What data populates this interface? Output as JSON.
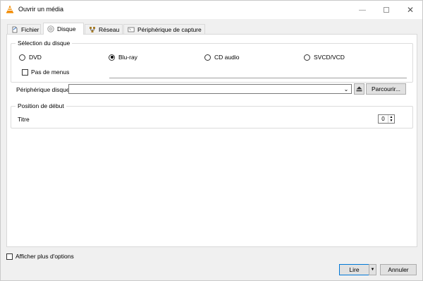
{
  "window": {
    "title": "Ouvrir un média"
  },
  "tabs": [
    {
      "label": "Fichier",
      "icon": "file-icon"
    },
    {
      "label": "Disque",
      "icon": "disc-icon",
      "active": true
    },
    {
      "label": "Réseau",
      "icon": "network-icon"
    },
    {
      "label": "Périphérique de capture",
      "icon": "capture-device-icon"
    }
  ],
  "disc_selection": {
    "title": "Sélection du disque",
    "options": [
      {
        "label": "DVD",
        "checked": false
      },
      {
        "label": "Blu-ray",
        "checked": true
      },
      {
        "label": "CD audio",
        "checked": false
      },
      {
        "label": "SVCD/VCD",
        "checked": false
      }
    ],
    "no_menus_label": "Pas de menus",
    "device_label": "Périphérique disque",
    "device_value": "",
    "browse_label": "Parcourir..."
  },
  "start_position": {
    "title": "Position de début",
    "title_label": "Titre",
    "title_value": "0"
  },
  "footer": {
    "more_options_label": "Afficher plus d'options",
    "play_label": "Lire",
    "cancel_label": "Annuler"
  },
  "colors": {
    "focus_border": "#0078d7",
    "vlc_orange": "#f28c00"
  }
}
